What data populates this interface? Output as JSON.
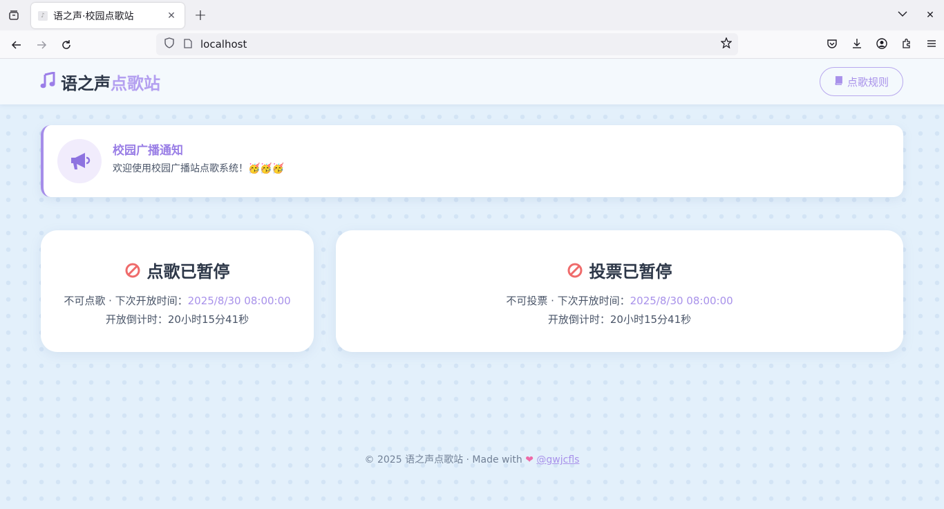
{
  "browser": {
    "tab_title": "语之声·校园点歌站",
    "url": "localhost"
  },
  "header": {
    "brand_main": "语之声",
    "brand_accent": "点歌站",
    "rules_button": "点歌规则"
  },
  "notice": {
    "title": "校园广播通知",
    "text": "欢迎使用校园广播站点歌系统！🥳🥳🥳"
  },
  "song_card": {
    "title": "点歌已暂停",
    "status_prefix": "不可点歌 · 下次开放时间：",
    "next_open": "2025/8/30 08:00:00",
    "countdown": "开放倒计时：20小时15分41秒"
  },
  "vote_card": {
    "title": "投票已暂停",
    "status_prefix": "不可投票 · 下次开放时间：",
    "next_open": "2025/8/30 08:00:00",
    "countdown": "开放倒计时：20小时15分41秒"
  },
  "footer": {
    "prefix": "© 2025 语之声点歌站 · Made with",
    "heart": "❤",
    "author": "@gwjcfls"
  },
  "colors": {
    "accent": "#a891ea",
    "page_bg": "#e3f0fb",
    "paused_icon": "#ef6b6b"
  },
  "icons": {
    "brand": "music-note-icon",
    "notice": "megaphone-icon",
    "rules": "book-icon",
    "paused": "ban-icon"
  }
}
